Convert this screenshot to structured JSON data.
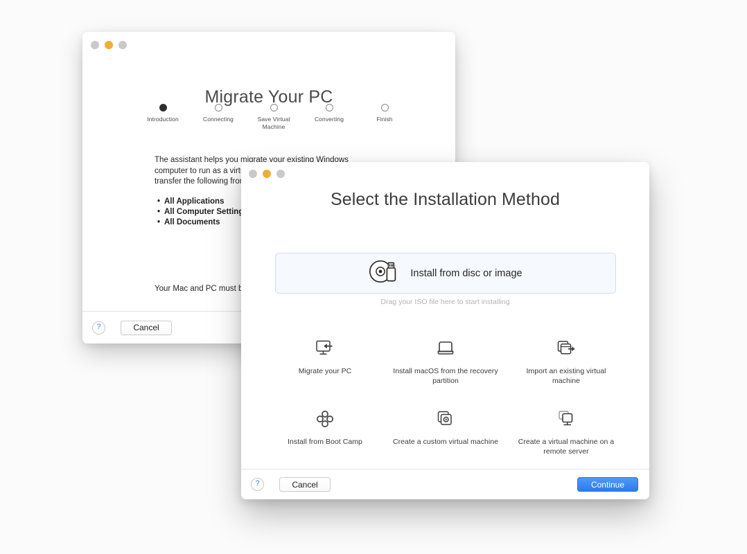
{
  "background_window": {
    "name": "migrate-your-pc-assistant",
    "title": "Migrate Your PC",
    "traffic_lights": {
      "close_color": "#c9c9c9",
      "minimize_color": "#f0ad38",
      "zoom_color": "#c9c9c9"
    },
    "stepper": {
      "steps": [
        {
          "label": "Introduction",
          "state": "current"
        },
        {
          "label": "Connecting",
          "state": "pending"
        },
        {
          "label": "Save Virtual Machine",
          "state": "pending"
        },
        {
          "label": "Converting",
          "state": "pending"
        },
        {
          "label": "Finish",
          "state": "pending"
        }
      ]
    },
    "body_paragraph": "The assistant helps you migrate your existing Windows computer to run as a virtual machine. The assistant will transfer the following from your PC:",
    "bullets": [
      "All Applications",
      "All Computer Settings",
      "All Documents"
    ],
    "note": "Your Mac and PC must be powered on during the migration.",
    "footer": {
      "help_label": "?",
      "cancel_label": "Cancel"
    }
  },
  "foreground_dialog": {
    "name": "select-installation-method",
    "title": "Select the Installation Method",
    "traffic_lights": {
      "close_color": "#c9c9c9",
      "minimize_color": "#f0ad38",
      "zoom_color": "#c9c9c9"
    },
    "primary_option": {
      "label": "Install from disc or image",
      "icon": "disc-and-usb-icon",
      "selected": true,
      "border_color": "#cfdeef",
      "background_color": "#f6f9fd"
    },
    "drag_hint": "Drag your ISO file here to start installing",
    "options": [
      {
        "label": "Migrate your PC",
        "icon": "monitor-arrow-in-icon"
      },
      {
        "label": "Install macOS from the recovery partition",
        "icon": "laptop-icon"
      },
      {
        "label": "Import an existing virtual machine",
        "icon": "import-window-arrow-icon"
      },
      {
        "label": "Install from Boot Camp",
        "icon": "boot-camp-diamond-icon"
      },
      {
        "label": "Create a custom virtual machine",
        "icon": "stacked-gear-window-icon"
      },
      {
        "label": "Create a virtual machine on a remote server",
        "icon": "remote-server-monitors-icon"
      }
    ],
    "footer": {
      "help_label": "?",
      "cancel_label": "Cancel",
      "continue_label": "Continue",
      "continue_color": "#2b7cee"
    }
  }
}
